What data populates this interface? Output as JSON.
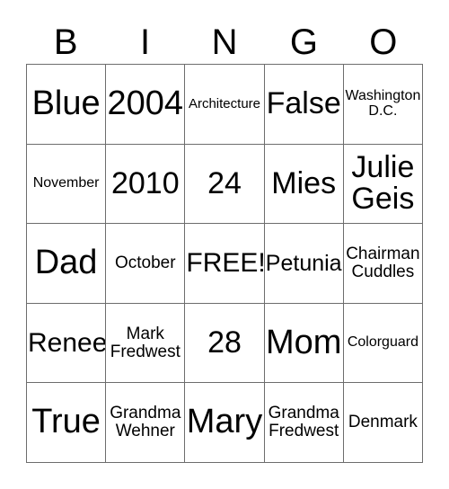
{
  "card": {
    "header_letters": [
      "B",
      "I",
      "N",
      "G",
      "O"
    ],
    "rows": [
      [
        {
          "text": "Blue",
          "size": "fs-xxl"
        },
        {
          "text": "2004",
          "size": "fs-xxl"
        },
        {
          "text": "Architecture",
          "size": "fs-xxs"
        },
        {
          "text": "False",
          "size": "fs-xl"
        },
        {
          "text": "Washington\nD.C.",
          "size": "fs-xs"
        }
      ],
      [
        {
          "text": "November",
          "size": "fs-xs"
        },
        {
          "text": "2010",
          "size": "fs-xl"
        },
        {
          "text": "24",
          "size": "fs-xl"
        },
        {
          "text": "Mies",
          "size": "fs-xl"
        },
        {
          "text": "Julie\nGeis",
          "size": "fs-xl"
        }
      ],
      [
        {
          "text": "Dad",
          "size": "fs-xxl"
        },
        {
          "text": "October",
          "size": "fs-s"
        },
        {
          "text": "FREE!",
          "size": "fs-l"
        },
        {
          "text": "Petunia",
          "size": "fs-m"
        },
        {
          "text": "Chairman\nCuddles",
          "size": "fs-s"
        }
      ],
      [
        {
          "text": "Renee",
          "size": "fs-l"
        },
        {
          "text": "Mark\nFredwest",
          "size": "fs-s"
        },
        {
          "text": "28",
          "size": "fs-xl"
        },
        {
          "text": "Mom",
          "size": "fs-xxl"
        },
        {
          "text": "Colorguard",
          "size": "fs-xs"
        }
      ],
      [
        {
          "text": "True",
          "size": "fs-xxl"
        },
        {
          "text": "Grandma\nWehner",
          "size": "fs-s"
        },
        {
          "text": "Mary",
          "size": "fs-xxl"
        },
        {
          "text": "Grandma\nFredwest",
          "size": "fs-s"
        },
        {
          "text": "Denmark",
          "size": "fs-s"
        }
      ]
    ]
  }
}
